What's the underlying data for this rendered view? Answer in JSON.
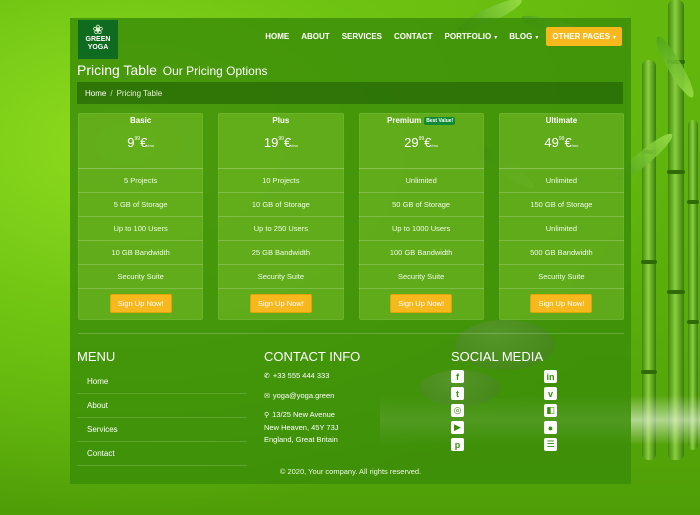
{
  "brand": {
    "line1": "GREEN",
    "line2": "YOGA",
    "mark": "❀"
  },
  "nav": {
    "items": [
      "HOME",
      "ABOUT",
      "SERVICES",
      "CONTACT",
      "PORTFOLIO",
      "BLOG",
      "OTHER PAGES"
    ],
    "dropdown_caret": "▾"
  },
  "page": {
    "title": "Pricing Table",
    "subtitle": "Our Pricing Options"
  },
  "breadcrumb": {
    "home": "Home",
    "separator": "/",
    "current": "Pricing Table"
  },
  "plans": [
    {
      "name": "Basic",
      "price_int": "9",
      "price_cents": "99",
      "currency": "€",
      "period": "/mo",
      "features": [
        "5 Projects",
        "5 GB of Storage",
        "Up to 100 Users",
        "10 GB Bandwidth",
        "Security Suite"
      ],
      "cta": "Sign Up Now!"
    },
    {
      "name": "Plus",
      "price_int": "19",
      "price_cents": "99",
      "currency": "€",
      "period": "/mo",
      "features": [
        "10 Projects",
        "10 GB of Storage",
        "Up to 250 Users",
        "25 GB Bandwidth",
        "Security Suite"
      ],
      "cta": "Sign Up Now!"
    },
    {
      "name": "Premium",
      "badge": "Best Value!",
      "price_int": "29",
      "price_cents": "99",
      "currency": "€",
      "period": "/mo",
      "features": [
        "Unlimited",
        "50 GB of Storage",
        "Up to 1000 Users",
        "100 GB Bandwidth",
        "Security Suite"
      ],
      "cta": "Sign Up Now!"
    },
    {
      "name": "Ultimate",
      "price_int": "49",
      "price_cents": "99",
      "currency": "€",
      "period": "/mo",
      "features": [
        "Unlimited",
        "150 GB of Storage",
        "Unlimited",
        "500 GB Bandwidth",
        "Security Suite"
      ],
      "cta": "Sign Up Now!"
    }
  ],
  "footer": {
    "menu_title": "MENU",
    "menu": [
      "Home",
      "About",
      "Services",
      "Contact"
    ],
    "contact_title": "CONTACT INFO",
    "phone": "+33 555 444 333",
    "email": "yoga@yoga.green",
    "address": [
      "13/25 New Avenue",
      "New Heaven, 45Y 73J",
      "England, Great Britain"
    ],
    "social_title": "SOCIAL MEDIA",
    "social_icons": [
      "facebook-icon",
      "twitter-icon",
      "instagram-icon",
      "youtube-icon",
      "pinterest-icon",
      "linkedin-icon",
      "vimeo-icon",
      "delicious-icon",
      "flickr-icon",
      "rss-icon"
    ],
    "copyright": "© 2020, Your company. All rights reserved."
  },
  "colors": {
    "accent": "#f6b81c",
    "panel": "#3a8c08",
    "badge": "#0f8a36"
  }
}
